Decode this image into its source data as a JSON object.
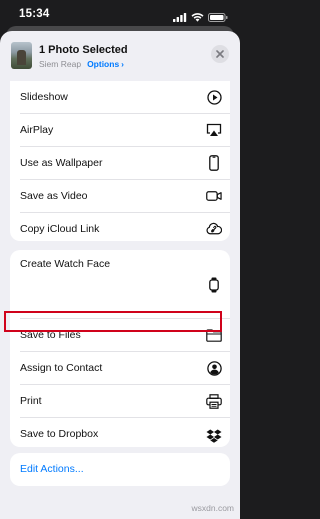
{
  "status_bar": {
    "time": "15:34",
    "icons": [
      "signal-icon",
      "wifi-icon",
      "battery-icon"
    ]
  },
  "header": {
    "title": "1 Photo Selected",
    "location": "Siem Reap",
    "options_label": "Options",
    "options_chevron": "›",
    "close_glyph": "✕"
  },
  "actions_group_1": [
    {
      "label": "Slideshow",
      "icon": "play-circle-icon"
    },
    {
      "label": "AirPlay",
      "icon": "airplay-icon"
    },
    {
      "label": "Use as Wallpaper",
      "icon": "phone-icon"
    },
    {
      "label": "Save as Video",
      "icon": "video-camera-icon"
    },
    {
      "label": "Copy iCloud Link",
      "icon": "cloud-link-icon"
    }
  ],
  "actions_group_2": [
    {
      "label": "Create Watch Face",
      "icon": "watch-icon"
    },
    {
      "label": "Save to Files",
      "icon": "folder-icon",
      "highlighted": true
    },
    {
      "label": "Assign to Contact",
      "icon": "contact-icon"
    },
    {
      "label": "Print",
      "icon": "printer-icon"
    },
    {
      "label": "Save to Dropbox",
      "icon": "dropbox-icon"
    }
  ],
  "edit_actions_label": "Edit Actions...",
  "watermark": "wsxdn.com",
  "colors": {
    "accent": "#007aff",
    "highlight": "#d0021b",
    "sheet_bg": "#efeff4"
  }
}
